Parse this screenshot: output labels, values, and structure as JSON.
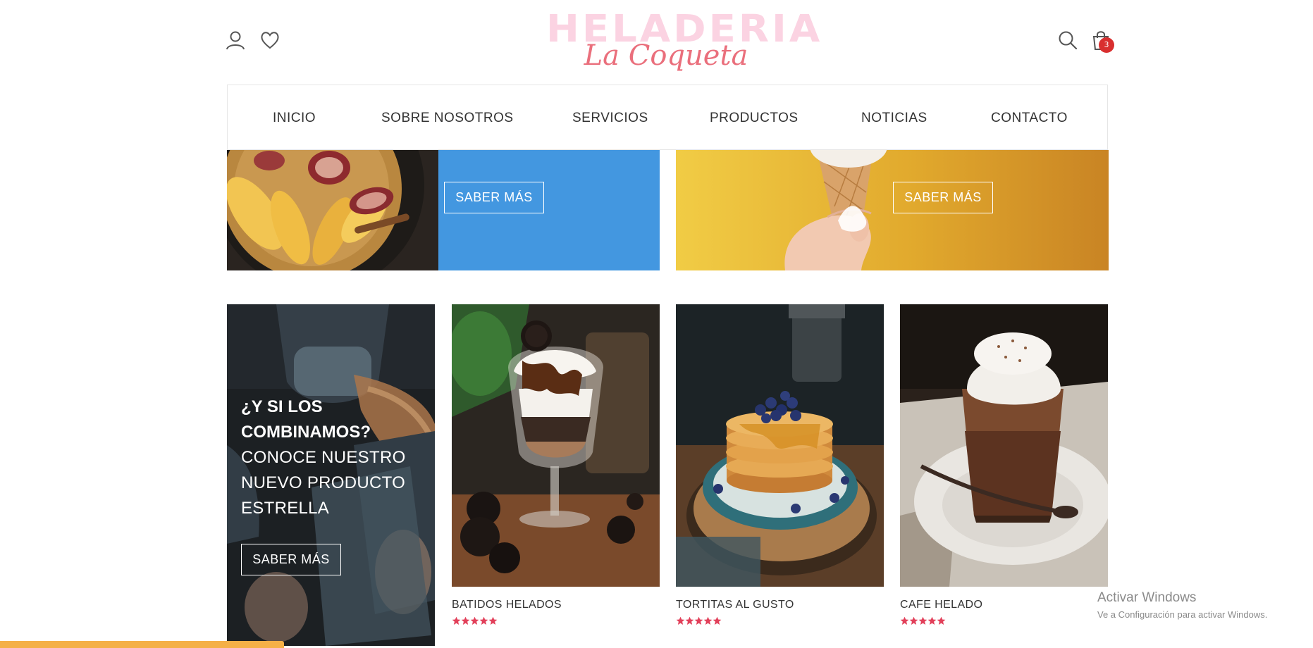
{
  "header": {
    "logo_top": "HELADERIA",
    "logo_bottom": "La Coqueta",
    "cart_count": "3",
    "icons": [
      "user-icon",
      "heart-icon",
      "search-icon",
      "shopping-bag-icon"
    ]
  },
  "nav": {
    "items": [
      {
        "label": "INICIO"
      },
      {
        "label": "SOBRE NOSOTROS"
      },
      {
        "label": "SERVICIOS"
      },
      {
        "label": "PRODUCTOS"
      },
      {
        "label": "NOTICIAS"
      },
      {
        "label": "CONTACTO"
      }
    ]
  },
  "banners": [
    {
      "button": "SABER MÁS",
      "color": "#4397e0"
    },
    {
      "button": "SABER MÁS",
      "color": "#e1a92d"
    }
  ],
  "promo": {
    "title": "¿Y SI LOS COMBINAMOS?",
    "subtitle": "CONOCE NUESTRO NUEVO PRODUCTO ESTRELLA",
    "button": "SABER MÁS"
  },
  "products": [
    {
      "name": "BATIDOS HELADOS",
      "rating": 5
    },
    {
      "name": "TORTITAS AL GUSTO",
      "rating": 5
    },
    {
      "name": "CAFE HELADO",
      "rating": 5
    }
  ],
  "os_overlay": {
    "title": "Activar Windows",
    "subtitle": "Ve a Configuración para activar Windows."
  },
  "colors": {
    "accent_star": "#e2405a",
    "logo_pink": "#fbd3e2",
    "logo_script": "#ea6f7c",
    "badge": "#d92f2f"
  }
}
